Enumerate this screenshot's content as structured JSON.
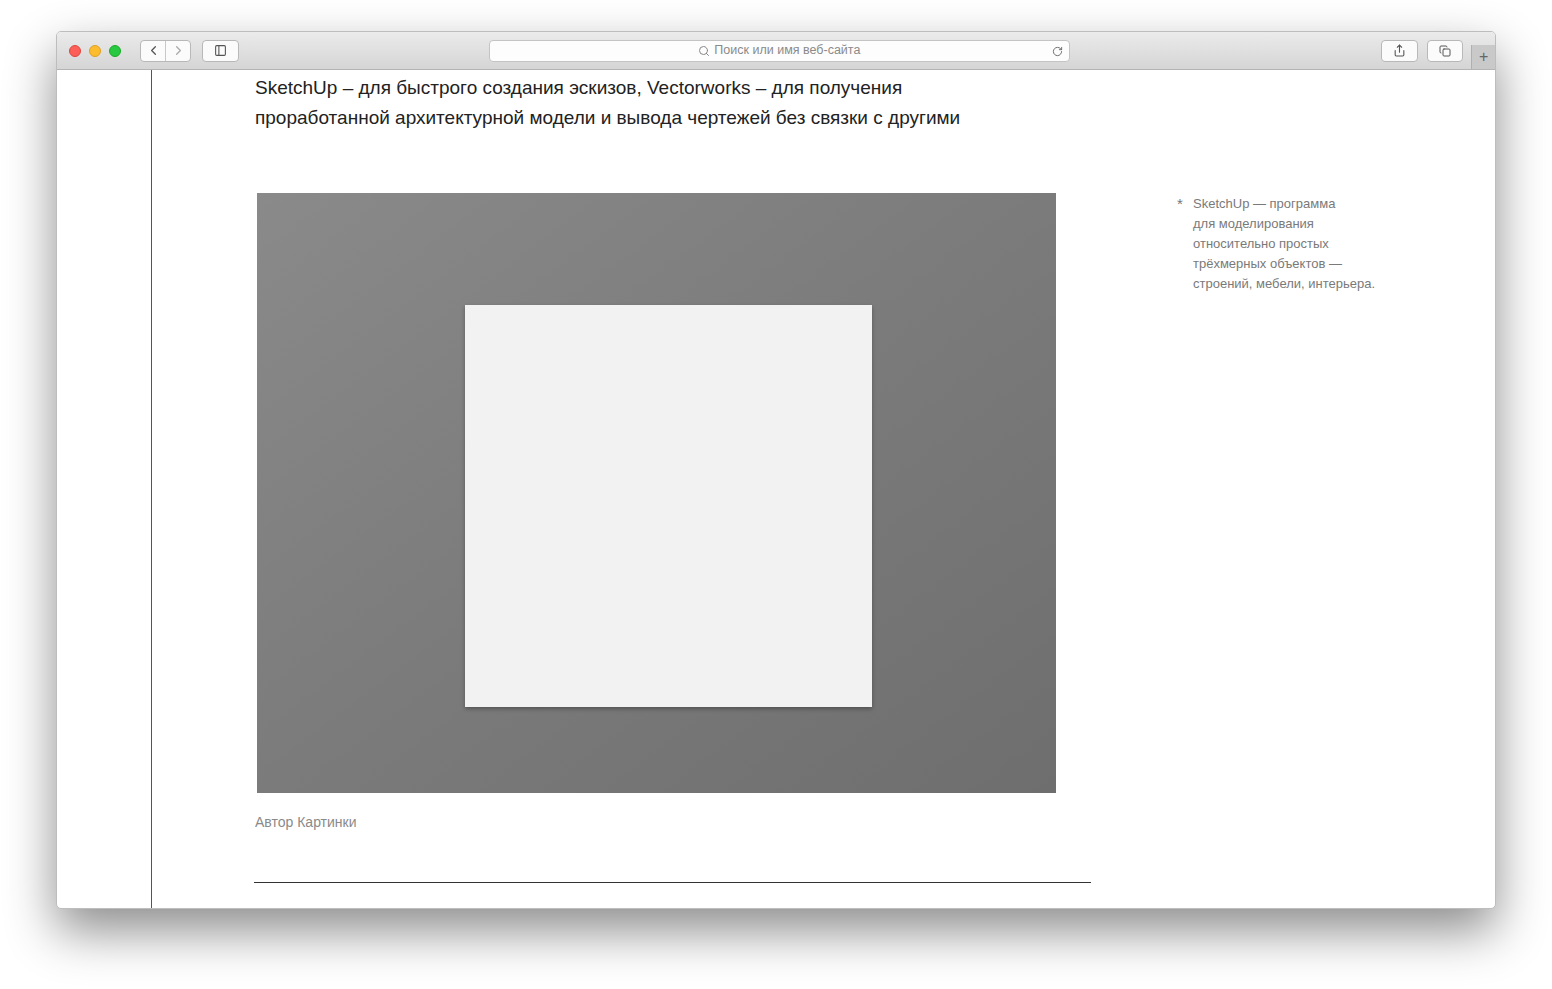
{
  "window": {
    "search": {
      "placeholder": "Поиск или имя веб-сайта"
    },
    "new_tab_button": "+"
  },
  "article": {
    "paragraph_lines": [
      "SketchUp – для быстрого создания эскизов, Vectorworks – для получения",
      "проработанной архитектурной модели и вывода чертежей без связки с другими"
    ],
    "image": {
      "caption": "Автор Картинки"
    },
    "sidenote": {
      "marker": "*",
      "lines": [
        "SketchUp — программа",
        "для моделирования",
        "относительно простых",
        "трёхмерных объектов —",
        "строений, мебели, интерьера."
      ]
    }
  }
}
